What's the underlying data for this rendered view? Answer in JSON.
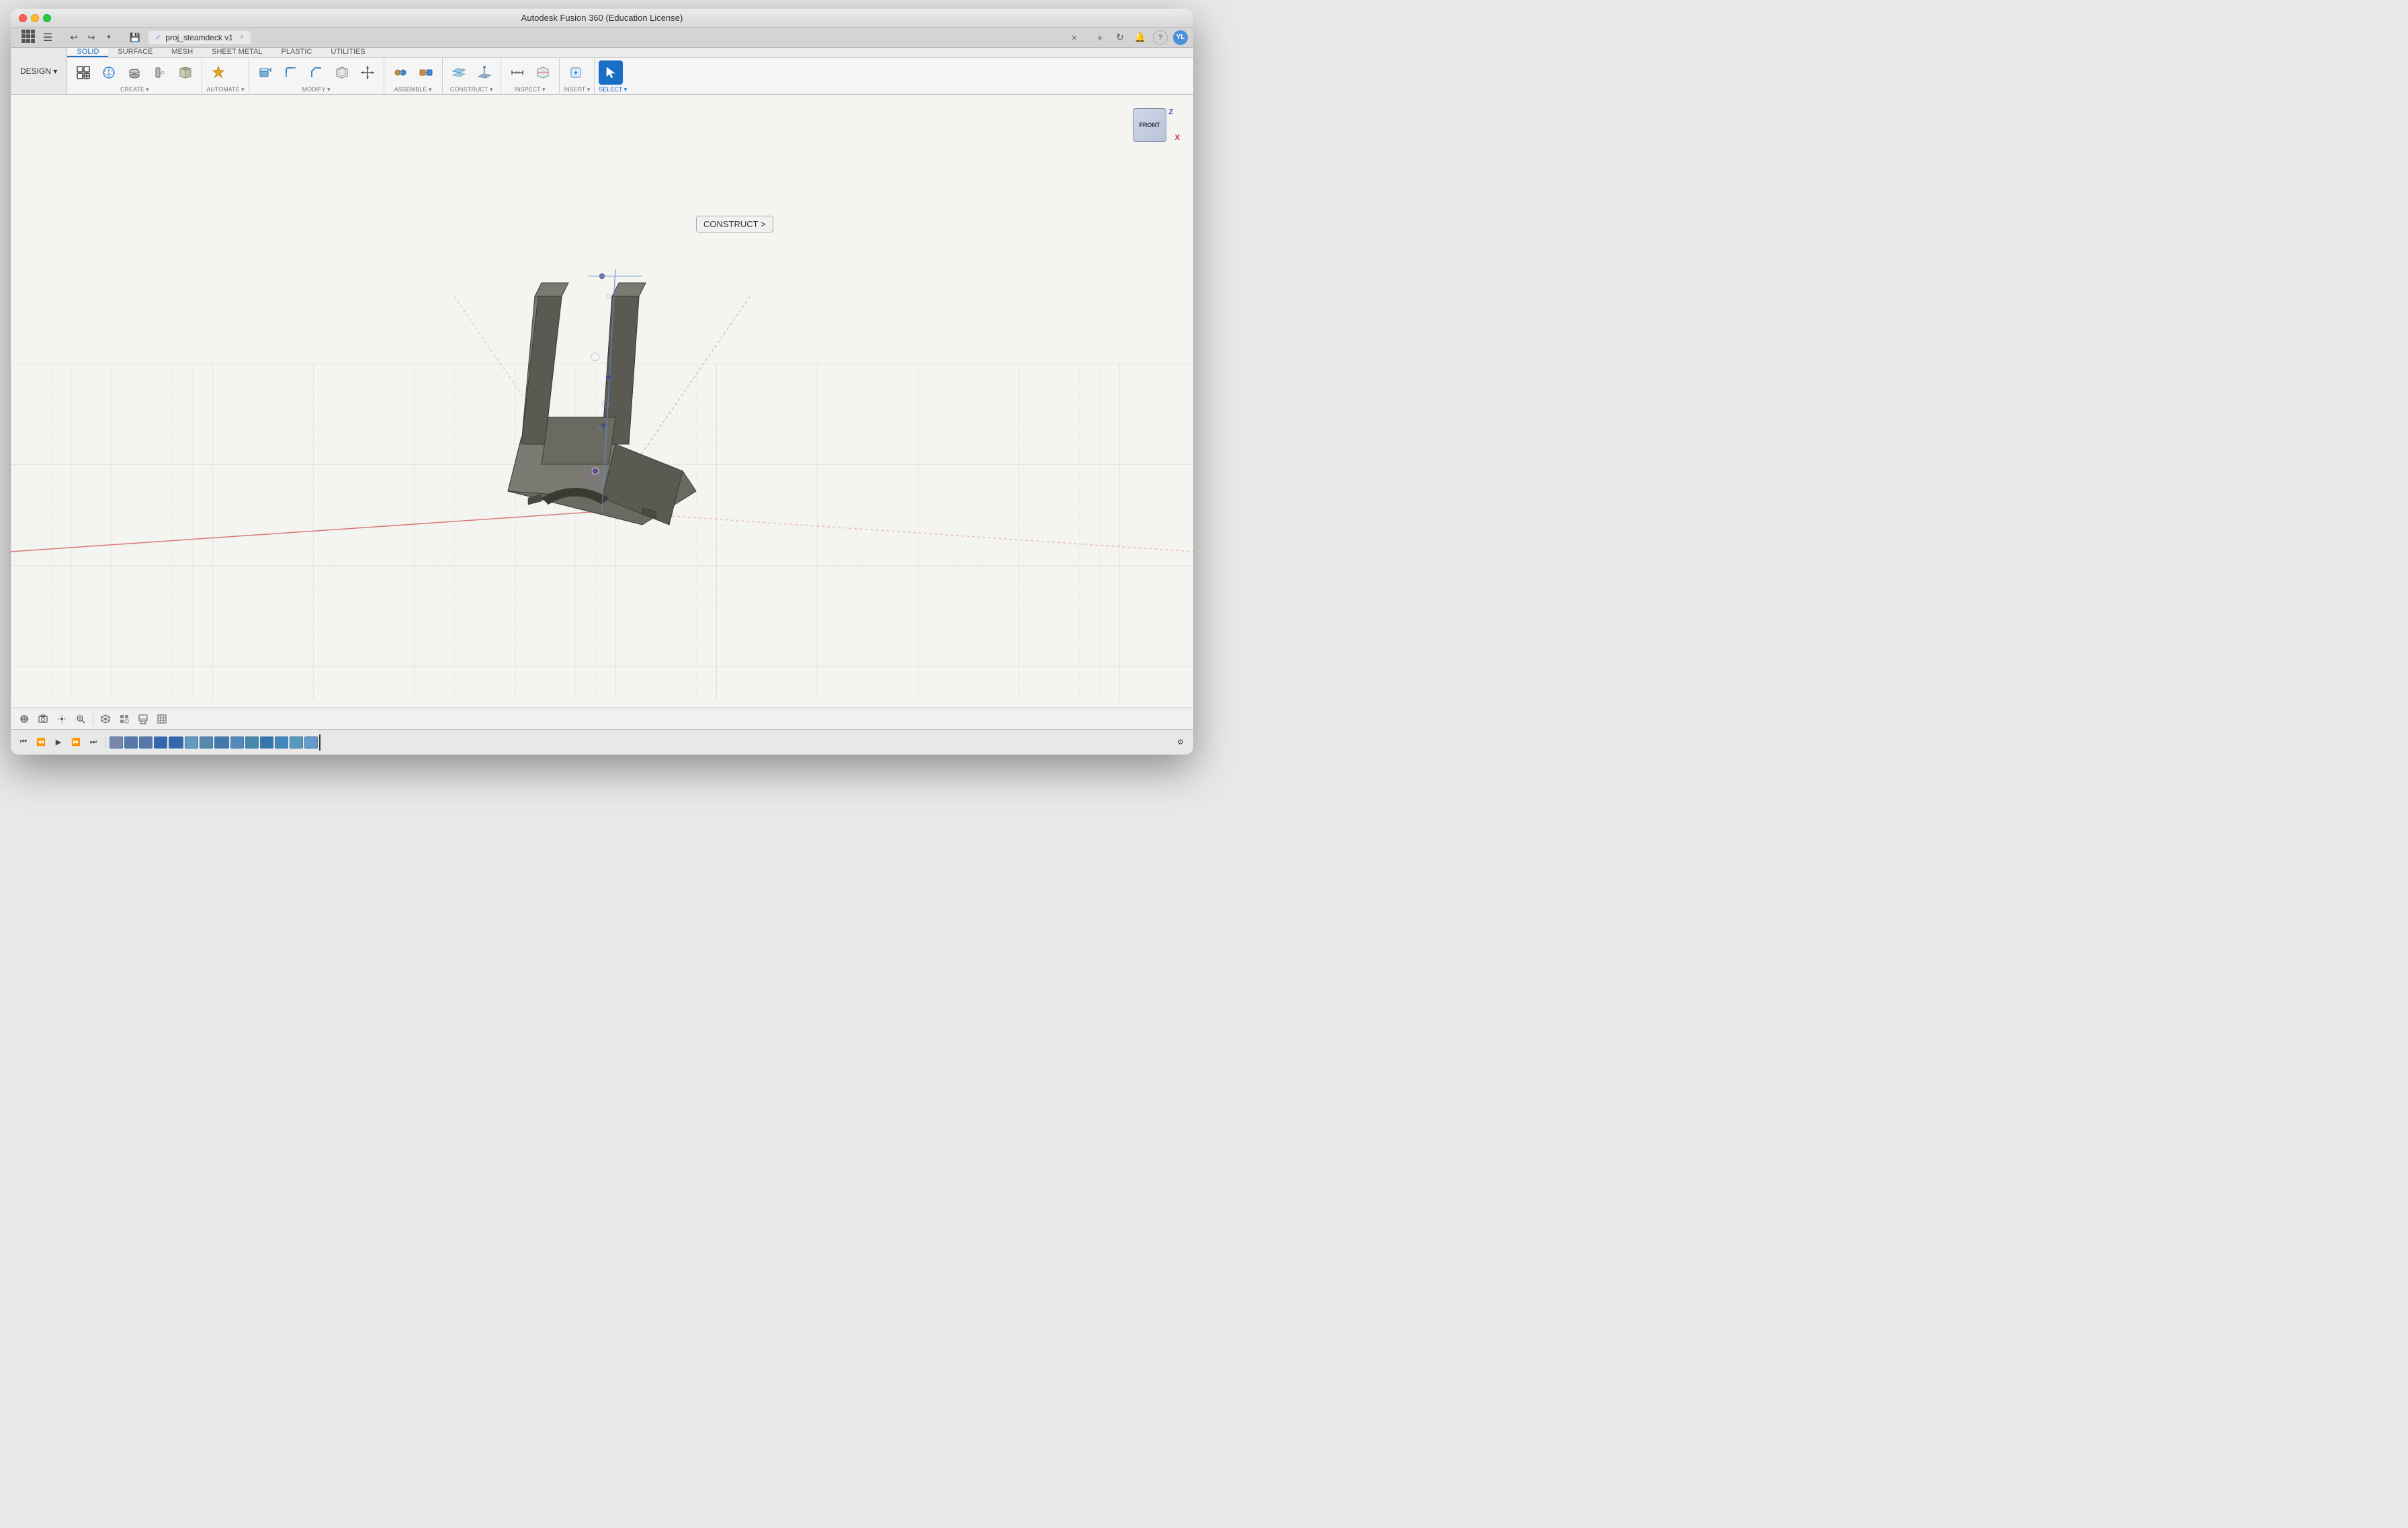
{
  "window": {
    "title": "Autodesk Fusion 360 (Education License)"
  },
  "tabbar": {
    "tab_label": "proj_steamdeck v1",
    "close_label": "×",
    "add_btn": "+",
    "refresh_btn": "↻",
    "bell_btn": "🔔",
    "help_btn": "?",
    "user_initials": "YL",
    "close_win": "×"
  },
  "toolbar": {
    "design_label": "DESIGN ▾",
    "tabs": [
      {
        "label": "SOLID",
        "active": true
      },
      {
        "label": "SURFACE",
        "active": false
      },
      {
        "label": "MESH",
        "active": false
      },
      {
        "label": "SHEET METAL",
        "active": false
      },
      {
        "label": "PLASTIC",
        "active": false
      },
      {
        "label": "UTILITIES",
        "active": false
      }
    ],
    "groups": [
      {
        "name": "CREATE",
        "tools": [
          {
            "icon": "⊞",
            "label": ""
          },
          {
            "icon": "⬡",
            "label": ""
          },
          {
            "icon": "◉",
            "label": ""
          },
          {
            "icon": "⊟",
            "label": ""
          },
          {
            "icon": "✦",
            "label": ""
          }
        ]
      },
      {
        "name": "AUTOMATE",
        "tools": [
          {
            "icon": "⚙",
            "label": ""
          }
        ]
      },
      {
        "name": "MODIFY",
        "tools": [
          {
            "icon": "◧",
            "label": ""
          },
          {
            "icon": "◫",
            "label": ""
          },
          {
            "icon": "◩",
            "label": ""
          },
          {
            "icon": "✂",
            "label": ""
          },
          {
            "icon": "⊕",
            "label": ""
          }
        ]
      },
      {
        "name": "ASSEMBLE",
        "tools": [
          {
            "icon": "⚙",
            "label": ""
          },
          {
            "icon": "🔗",
            "label": ""
          }
        ]
      },
      {
        "name": "CONSTRUCT",
        "tools": [
          {
            "icon": "📐",
            "label": ""
          },
          {
            "icon": "🖼",
            "label": ""
          }
        ]
      },
      {
        "name": "INSPECT",
        "tools": [
          {
            "icon": "📏",
            "label": ""
          },
          {
            "icon": "🔍",
            "label": ""
          }
        ]
      },
      {
        "name": "INSERT",
        "tools": [
          {
            "icon": "⬇",
            "label": ""
          }
        ]
      },
      {
        "name": "SELECT",
        "tools": [
          {
            "icon": "↖",
            "label": ""
          }
        ]
      }
    ]
  },
  "construct_tooltip": "CONSTRUCT >",
  "nav_cube": {
    "face_label": "FRONT",
    "z_label": "Z",
    "x_label": "X"
  },
  "bottom_toolbar": {
    "buttons": [
      "⊕",
      "📷",
      "✋",
      "🔍",
      "↔",
      "⬜",
      "⊞"
    ],
    "view_icons": [
      "⊞",
      "⬜",
      "⊟"
    ]
  },
  "timeline": {
    "play_back_end": "⏮",
    "play_back": "⏪",
    "play": "▶",
    "play_fwd": "⏩",
    "play_fwd_end": "⏭",
    "items_count": 14
  },
  "statusbar": {
    "settings_icon": "⚙"
  }
}
